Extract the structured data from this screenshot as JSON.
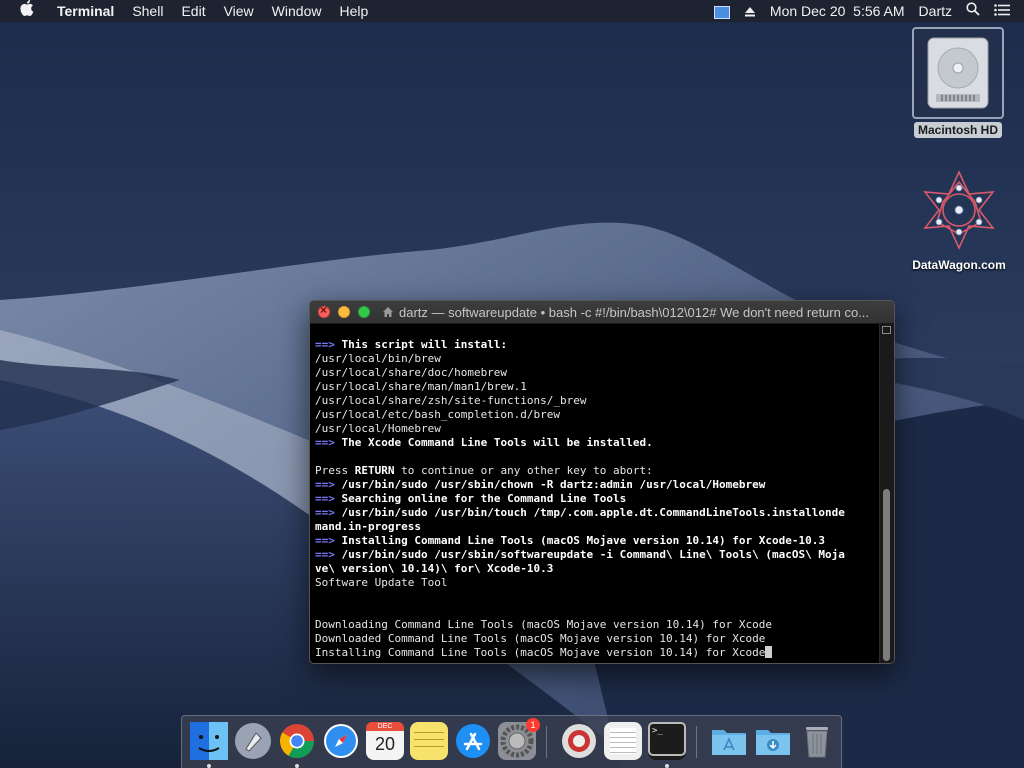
{
  "menubar": {
    "apple": "",
    "app_name": "Terminal",
    "menus": [
      "Shell",
      "Edit",
      "View",
      "Window",
      "Help"
    ],
    "datetime": "Mon Dec 20  5:56 AM",
    "user": "Dartz"
  },
  "desktop_icons": {
    "hd_label": "Macintosh HD",
    "dw_label": "DataWagon.com"
  },
  "terminal": {
    "title": "dartz — softwareupdate • bash -c #!/bin/bash\\012\\012# We don't need return co...",
    "lines": [
      {
        "arrow": "==>",
        "text": "This script will install:",
        "bold": true
      },
      {
        "arrow": "",
        "text": "/usr/local/bin/brew",
        "bold": false
      },
      {
        "arrow": "",
        "text": "/usr/local/share/doc/homebrew",
        "bold": false
      },
      {
        "arrow": "",
        "text": "/usr/local/share/man/man1/brew.1",
        "bold": false
      },
      {
        "arrow": "",
        "text": "/usr/local/share/zsh/site-functions/_brew",
        "bold": false
      },
      {
        "arrow": "",
        "text": "/usr/local/etc/bash_completion.d/brew",
        "bold": false
      },
      {
        "arrow": "",
        "text": "/usr/local/Homebrew",
        "bold": false
      },
      {
        "arrow": "==>",
        "text": "The Xcode Command Line Tools will be installed.",
        "bold": true
      },
      {
        "arrow": "",
        "text": "",
        "bold": false
      },
      {
        "arrow": "",
        "text": "Press RETURN to continue or any other key to abort:",
        "bold": false,
        "highlight": "RETURN"
      },
      {
        "arrow": "==>",
        "text": "/usr/bin/sudo /usr/sbin/chown -R dartz:admin /usr/local/Homebrew",
        "bold": true
      },
      {
        "arrow": "==>",
        "text": "Searching online for the Command Line Tools",
        "bold": true
      },
      {
        "arrow": "==>",
        "text": "/usr/bin/sudo /usr/bin/touch /tmp/.com.apple.dt.CommandLineTools.installonde",
        "bold": true
      },
      {
        "arrow": "",
        "text": "mand.in-progress",
        "bold": true
      },
      {
        "arrow": "==>",
        "text": "Installing Command Line Tools (macOS Mojave version 10.14) for Xcode-10.3",
        "bold": true
      },
      {
        "arrow": "==>",
        "text": "/usr/bin/sudo /usr/sbin/softwareupdate -i Command\\ Line\\ Tools\\ (macOS\\ Moja",
        "bold": true
      },
      {
        "arrow": "",
        "text": "ve\\ version\\ 10.14)\\ for\\ Xcode-10.3",
        "bold": true
      },
      {
        "arrow": "",
        "text": "Software Update Tool",
        "bold": false
      },
      {
        "arrow": "",
        "text": "",
        "bold": false
      },
      {
        "arrow": "",
        "text": "",
        "bold": false
      },
      {
        "arrow": "",
        "text": "Downloading Command Line Tools (macOS Mojave version 10.14) for Xcode",
        "bold": false
      },
      {
        "arrow": "",
        "text": "Downloaded Command Line Tools (macOS Mojave version 10.14) for Xcode",
        "bold": false
      },
      {
        "arrow": "",
        "text": "Installing Command Line Tools (macOS Mojave version 10.14) for Xcode",
        "bold": false,
        "cursor": true
      }
    ]
  },
  "dock": {
    "items": [
      {
        "name": "finder-icon",
        "color": "#3d8ef0",
        "running": true
      },
      {
        "name": "launchpad-icon",
        "color": "#8a94a6",
        "running": false
      },
      {
        "name": "chrome-icon",
        "color": "#e8e8e8",
        "running": true
      },
      {
        "name": "safari-icon",
        "color": "#2f8ff0",
        "running": false
      },
      {
        "name": "calendar-icon",
        "color": "#f4f4f4",
        "running": false,
        "text": "20",
        "month": "DEC"
      },
      {
        "name": "notes-icon",
        "color": "#f7e26b",
        "running": false
      },
      {
        "name": "app-store-icon",
        "color": "#1e8ff4",
        "running": false
      },
      {
        "name": "system-preferences-icon",
        "color": "#8d8f96",
        "running": false,
        "badge": "1"
      },
      {
        "name": "photo-booth-icon",
        "color": "#c9c9c9",
        "running": false
      },
      {
        "name": "textedit-icon",
        "color": "#efefef",
        "running": false
      },
      {
        "name": "terminal-icon",
        "color": "#1c1c1c",
        "running": true
      },
      {
        "name": "applications-folder-icon",
        "color": "#6bb7e8",
        "running": false
      },
      {
        "name": "downloads-folder-icon",
        "color": "#6bb7e8",
        "running": false
      },
      {
        "name": "trash-icon",
        "color": "#9aa0a8",
        "running": false
      }
    ]
  }
}
